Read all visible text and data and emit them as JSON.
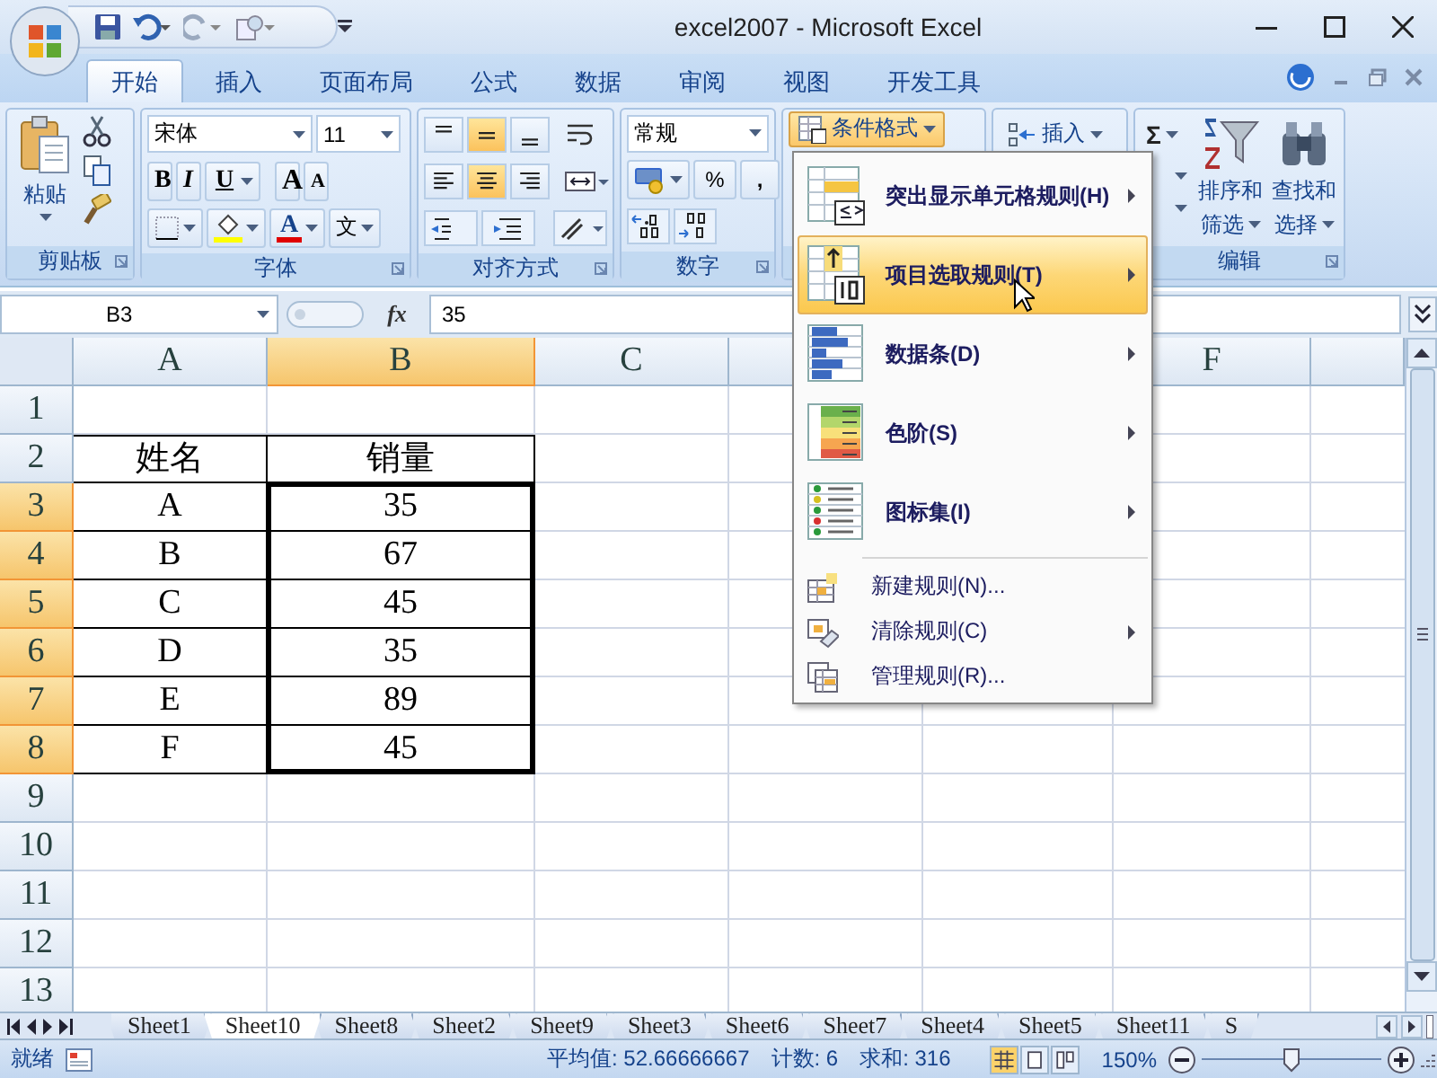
{
  "window": {
    "title": "excel2007 - Microsoft Excel"
  },
  "tabs": [
    {
      "label": "开始",
      "selected": true
    },
    {
      "label": "插入",
      "selected": false
    },
    {
      "label": "页面布局",
      "selected": false
    },
    {
      "label": "公式",
      "selected": false
    },
    {
      "label": "数据",
      "selected": false
    },
    {
      "label": "审阅",
      "selected": false
    },
    {
      "label": "视图",
      "selected": false
    },
    {
      "label": "开发工具",
      "selected": false
    }
  ],
  "ribbon": {
    "clipboard": {
      "paste": "粘贴",
      "label": "剪贴板"
    },
    "font": {
      "name": "宋体",
      "size": "11",
      "bold": "B",
      "italic": "I",
      "underline": "U",
      "grow": "A",
      "shrink": "A",
      "font_color_button": "A",
      "phonetic": "文",
      "label": "字体"
    },
    "alignment": {
      "vertical": [
        {
          "selected": false
        },
        {
          "selected": true
        },
        {
          "selected": false
        }
      ],
      "horizontal": [
        {
          "selected": false
        },
        {
          "selected": true
        },
        {
          "selected": false
        }
      ],
      "label": "对齐方式"
    },
    "number": {
      "format": "常规",
      "percent": "%",
      "comma": ",",
      "label": "数字"
    },
    "styles": {
      "conditional_format": "条件格式",
      "open": true
    },
    "cells": {
      "insert": "插入"
    },
    "editing": {
      "sum": "Σ",
      "sort": [
        "排序和",
        "筛选"
      ],
      "find": [
        "查找和",
        "选择"
      ],
      "label": "编辑"
    }
  },
  "formula_bar": {
    "name_box": "B3",
    "fx": "fx",
    "value": "35"
  },
  "columns": [
    {
      "label": "A",
      "selected": false
    },
    {
      "label": "B",
      "selected": true
    },
    {
      "label": "C",
      "selected": false
    },
    {
      "selected": false
    },
    {
      "label": "F",
      "selected": false
    },
    {
      "selected": false
    }
  ],
  "rows": [
    {
      "header": "1",
      "selected": false
    },
    {
      "header": "2",
      "selected": false,
      "cells": [
        "姓名",
        "销量"
      ]
    },
    {
      "header": "3",
      "selected": true,
      "cells": [
        "A",
        "35"
      ]
    },
    {
      "header": "4",
      "selected": true,
      "cells": [
        "B",
        "67"
      ]
    },
    {
      "header": "5",
      "selected": true,
      "cells": [
        "C",
        "45"
      ]
    },
    {
      "header": "6",
      "selected": true,
      "cells": [
        "D",
        "35"
      ]
    },
    {
      "header": "7",
      "selected": true,
      "cells": [
        "E",
        "89"
      ]
    },
    {
      "header": "8",
      "selected": true,
      "cells": [
        "F",
        "45"
      ]
    },
    {
      "header": "9",
      "selected": false
    },
    {
      "header": "10",
      "selected": false
    },
    {
      "header": "11",
      "selected": false
    },
    {
      "header": "12",
      "selected": false
    },
    {
      "header": "13",
      "selected": false
    }
  ],
  "menu": {
    "items": [
      {
        "kind": "large",
        "label": "突出显示单元格规则(H)",
        "submenu": true,
        "selected": false
      },
      {
        "kind": "large",
        "label": "项目选取规则(T)",
        "submenu": true,
        "selected": true
      },
      {
        "kind": "large",
        "label": "数据条(D)",
        "submenu": true,
        "selected": false
      },
      {
        "kind": "large",
        "label": "色阶(S)",
        "submenu": true,
        "selected": false
      },
      {
        "kind": "large",
        "label": "图标集(I)",
        "submenu": true,
        "selected": false
      },
      {
        "kind": "small",
        "label": "新建规则(N)...",
        "submenu": false,
        "selected": false
      },
      {
        "kind": "small",
        "label": "清除规则(C)",
        "submenu": true,
        "selected": false
      },
      {
        "kind": "small",
        "label": "管理规则(R)...",
        "submenu": false,
        "selected": false
      }
    ]
  },
  "sheet_tabs": [
    {
      "label": "Sheet1",
      "selected": false
    },
    {
      "label": "Sheet10",
      "selected": true
    },
    {
      "label": "Sheet8",
      "selected": false
    },
    {
      "label": "Sheet2",
      "selected": false
    },
    {
      "label": "Sheet9",
      "selected": false
    },
    {
      "label": "Sheet3",
      "selected": false
    },
    {
      "label": "Sheet6",
      "selected": false
    },
    {
      "label": "Sheet7",
      "selected": false
    },
    {
      "label": "Sheet4",
      "selected": false
    },
    {
      "label": "Sheet5",
      "selected": false
    },
    {
      "label": "Sheet11",
      "selected": false
    },
    {
      "label": "S",
      "selected": false
    }
  ],
  "status_bar": {
    "ready": "就绪",
    "average": "平均值: 52.66666667",
    "count": "计数: 6",
    "sum": "求和: 316",
    "views": [
      {
        "selected": true
      },
      {
        "selected": false
      },
      {
        "selected": false
      }
    ],
    "zoom": "150%",
    "zoom_slider": {
      "level": 0.5
    }
  }
}
